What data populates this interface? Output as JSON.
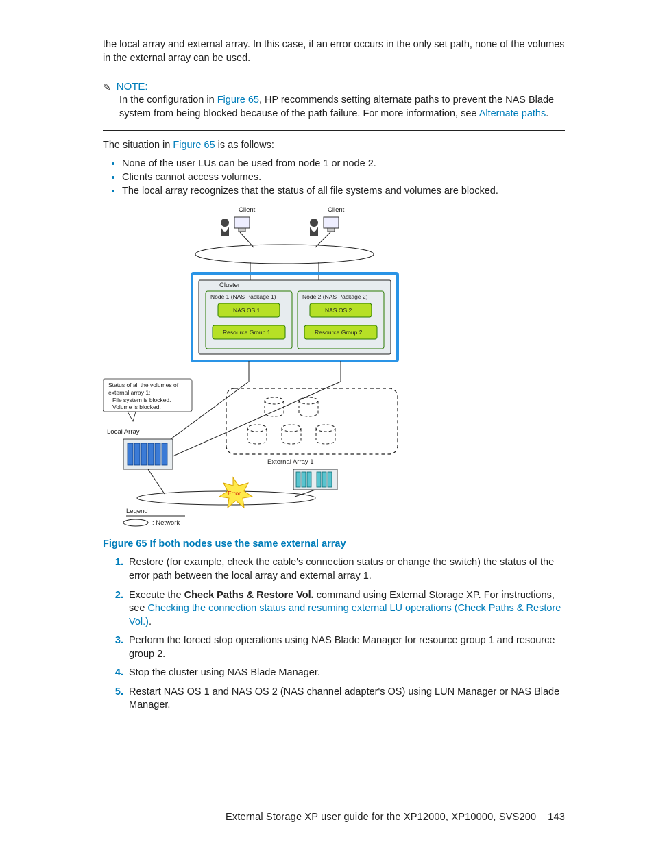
{
  "intro_para": "the local array and external array. In this case, if an error occurs in the only set path, none of the volumes in the external array can be used.",
  "note": {
    "label": "NOTE:",
    "text_before_link1": "In the configuration in ",
    "link1": "Figure 65",
    "text_mid": ", HP recommends setting alternate paths to prevent the NAS Blade system from being blocked because of the path failure. For more information, see ",
    "link2": "Alternate paths",
    "text_after": "."
  },
  "situation": {
    "before": "The situation in ",
    "link": "Figure 65",
    "after": " is as follows:"
  },
  "bullets": [
    "None of the user LUs can be used from node 1 or node 2.",
    "Clients cannot access volumes.",
    "The local array recognizes that the status of all file systems and volumes are blocked."
  ],
  "diagram": {
    "client1": "Client",
    "client2": "Client",
    "cluster": "Cluster",
    "node1": "Node 1 (NAS Package 1)",
    "node2": "Node 2 (NAS Package 2)",
    "nasos1": "NAS OS 1",
    "nasos2": "NAS OS 2",
    "rg1": "Resource Group 1",
    "rg2": "Resource Group 2",
    "callout_l1": "Status of all the volumes of",
    "callout_l2": "external array 1:",
    "callout_l3": "File system is blocked.",
    "callout_l4": "Volume is blocked.",
    "local_array": "Local Array",
    "ext_array": "External Array 1",
    "error": "Error",
    "legend": "Legend",
    "legend_net": ": Network"
  },
  "figure_caption": "Figure 65 If both nodes use the same external array",
  "steps": {
    "s1": "Restore (for example, check the cable's connection status or change the switch) the status of the error path between the local array and external array 1.",
    "s2_a": "Execute the ",
    "s2_bold": "Check Paths & Restore Vol.",
    "s2_b": " command using External Storage XP. For instructions, see ",
    "s2_link": "Checking the connection status and resuming external LU operations (Check Paths & Restore Vol.)",
    "s2_c": ".",
    "s3": "Perform the forced stop operations using NAS Blade Manager for resource group 1 and resource group 2.",
    "s4": "Stop the cluster using NAS Blade Manager.",
    "s5": "Restart NAS OS 1 and NAS OS 2 (NAS channel adapter's OS) using LUN Manager or NAS Blade Manager."
  },
  "footer": {
    "title": "External Storage XP user guide for the XP12000, XP10000, SVS200",
    "page": "143"
  }
}
